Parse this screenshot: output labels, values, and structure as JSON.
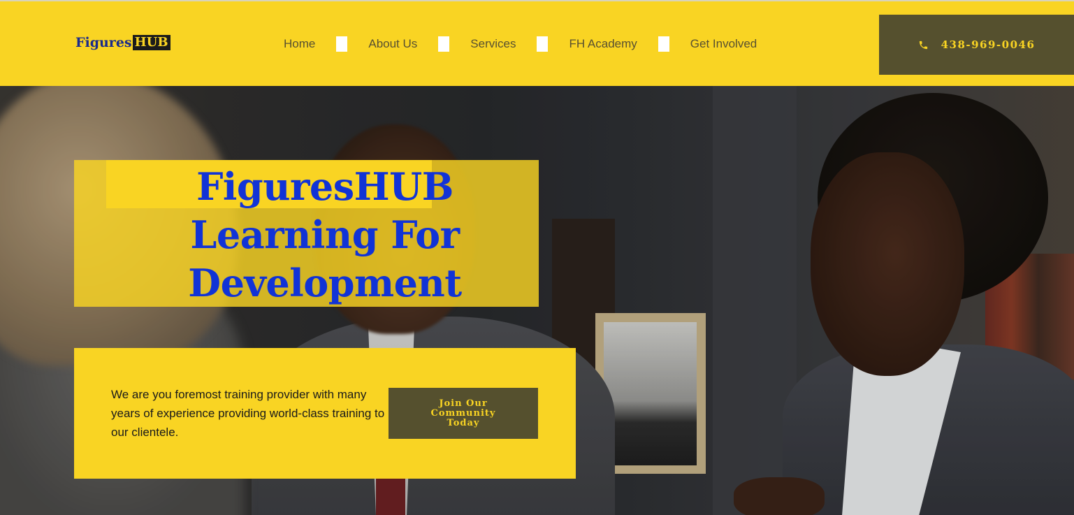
{
  "header": {
    "logo": {
      "part1": "Figures",
      "part2": "HUB"
    },
    "nav": [
      {
        "label": "Home"
      },
      {
        "label": "About Us"
      },
      {
        "label": "Services"
      },
      {
        "label": "FH Academy"
      },
      {
        "label": "Get Involved"
      }
    ],
    "phone": {
      "icon": "phone-icon",
      "number": "438-969-0046"
    }
  },
  "hero": {
    "title_line1": "FiguresHUB",
    "title_line2": "Learning For",
    "title_line3": "Development",
    "description": "We are you foremost training provider with many years of experience providing world-class training to our clientele.",
    "cta_label": "Join Our Community Today"
  },
  "colors": {
    "brand_yellow": "#f9d423",
    "brand_olive": "#55502e",
    "title_blue": "#1133d6",
    "logo_navy": "#1a2b8c"
  }
}
